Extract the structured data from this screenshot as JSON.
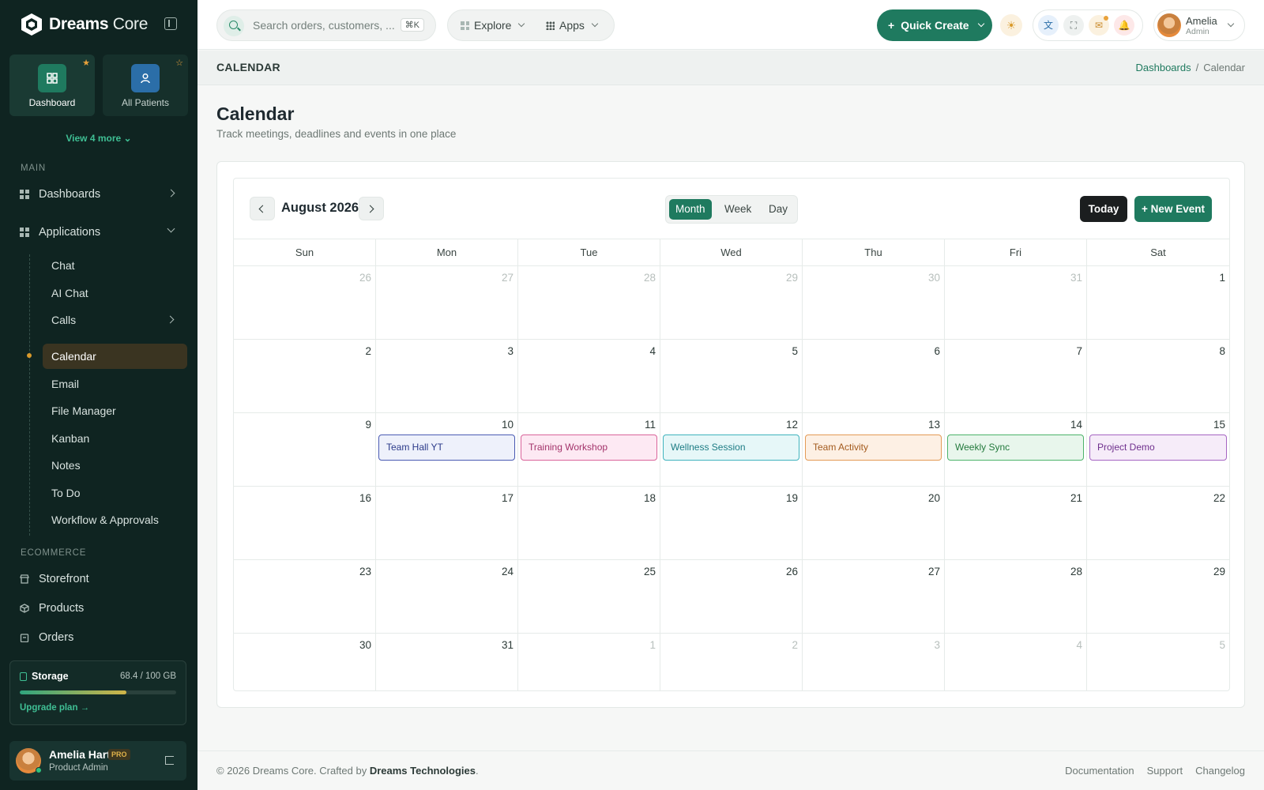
{
  "brand": {
    "name_bold": "Dreams",
    "name_light": "Core"
  },
  "sidebar": {
    "quick_tiles": [
      {
        "label": "Dashboard",
        "icon": "dashboard-icon",
        "starred": true
      },
      {
        "label": "All Patients",
        "icon": "patient-icon",
        "starred": false
      }
    ],
    "view_more": "View 4 more",
    "main_label": "MAIN",
    "main_items": [
      {
        "label": "Dashboards",
        "icon": "grid-icon",
        "expanded": false
      },
      {
        "label": "Applications",
        "icon": "grid-icon",
        "expanded": true
      }
    ],
    "app_items": [
      "Chat",
      "AI Chat",
      "Calls",
      "Calendar",
      "Email",
      "File Manager",
      "Kanban",
      "Notes",
      "To Do",
      "Workflow & Approvals"
    ],
    "active_item": "Calendar",
    "ecommerce_label": "ECOMMERCE",
    "ecommerce_items": [
      {
        "label": "Storefront",
        "icon": "store-icon"
      },
      {
        "label": "Products",
        "icon": "box-icon"
      },
      {
        "label": "Orders",
        "icon": "clipboard-icon"
      }
    ],
    "storage": {
      "title": "Storage",
      "value": "68.4 / 100 GB",
      "used_fraction": 0.684,
      "upgrade": "Upgrade plan →"
    },
    "user": {
      "name": "Amelia Hart",
      "badge": "PRO",
      "role": "Product Admin"
    }
  },
  "topbar": {
    "search_placeholder": "Search orders, customers, ...",
    "shortcut": "⌘K",
    "explore": "Explore",
    "apps": "Apps",
    "quick_create": "Quick Create",
    "profile": {
      "name": "Amelia",
      "role": "Admin"
    }
  },
  "page": {
    "bar_title": "CALENDAR",
    "breadcrumb": [
      "Dashboards",
      "Calendar"
    ],
    "title": "Calendar",
    "subtitle": "Track meetings, deadlines and events in one place"
  },
  "calendar": {
    "month": "August 2026",
    "views": [
      "Month",
      "Week",
      "Day"
    ],
    "active_view": "Month",
    "today": "Today",
    "new_event": "+ New Event",
    "weekdays": [
      "Sun",
      "Mon",
      "Tue",
      "Wed",
      "Thu",
      "Fri",
      "Sat"
    ],
    "days": [
      {
        "d": "26",
        "m": true
      },
      {
        "d": "27",
        "m": true
      },
      {
        "d": "28",
        "m": true
      },
      {
        "d": "29",
        "m": true
      },
      {
        "d": "30",
        "m": true
      },
      {
        "d": "31",
        "m": true
      },
      {
        "d": "1"
      },
      {
        "d": "2"
      },
      {
        "d": "3"
      },
      {
        "d": "4"
      },
      {
        "d": "5"
      },
      {
        "d": "6"
      },
      {
        "d": "7"
      },
      {
        "d": "8"
      },
      {
        "d": "9"
      },
      {
        "d": "10",
        "e": 0
      },
      {
        "d": "11",
        "e": 1
      },
      {
        "d": "12",
        "e": 2
      },
      {
        "d": "13",
        "e": 3
      },
      {
        "d": "14",
        "e": 4
      },
      {
        "d": "15",
        "e": 5
      },
      {
        "d": "16"
      },
      {
        "d": "17"
      },
      {
        "d": "18"
      },
      {
        "d": "19"
      },
      {
        "d": "20"
      },
      {
        "d": "21"
      },
      {
        "d": "22"
      },
      {
        "d": "23"
      },
      {
        "d": "24"
      },
      {
        "d": "25"
      },
      {
        "d": "26"
      },
      {
        "d": "27"
      },
      {
        "d": "28"
      },
      {
        "d": "29"
      },
      {
        "d": "30"
      },
      {
        "d": "31"
      },
      {
        "d": "1",
        "m": true
      },
      {
        "d": "2",
        "m": true
      },
      {
        "d": "3",
        "m": true
      },
      {
        "d": "4",
        "m": true
      },
      {
        "d": "5",
        "m": true
      }
    ],
    "events": [
      {
        "title": "Team Hall YT",
        "bg": "#eef1fb",
        "border": "#4a5bb3",
        "color": "#2b3a8a"
      },
      {
        "title": "Training Workshop",
        "bg": "#fde9f3",
        "border": "#d9649a",
        "color": "#a3336a"
      },
      {
        "title": "Wellness Session",
        "bg": "#e6f7f8",
        "border": "#3fb3bd",
        "color": "#1d7c84"
      },
      {
        "title": "Team Activity",
        "bg": "#fdf0e4",
        "border": "#e39a55",
        "color": "#a35a1d"
      },
      {
        "title": "Weekly Sync",
        "bg": "#e8f6ec",
        "border": "#4cb36a",
        "color": "#237a3d"
      },
      {
        "title": "Project Demo",
        "bg": "#f6ecf9",
        "border": "#a565c2",
        "color": "#6f2f8d"
      }
    ]
  },
  "footer": {
    "copy_prefix": "© 2026 Dreams Core. Crafted by ",
    "copy_brand": "Dreams Technologies",
    "links": [
      "Documentation",
      "Support",
      "Changelog"
    ]
  },
  "colors": {
    "accent": "#1f7a5f",
    "sidebar": "#0f2421",
    "active_nav": "#3a3421"
  }
}
